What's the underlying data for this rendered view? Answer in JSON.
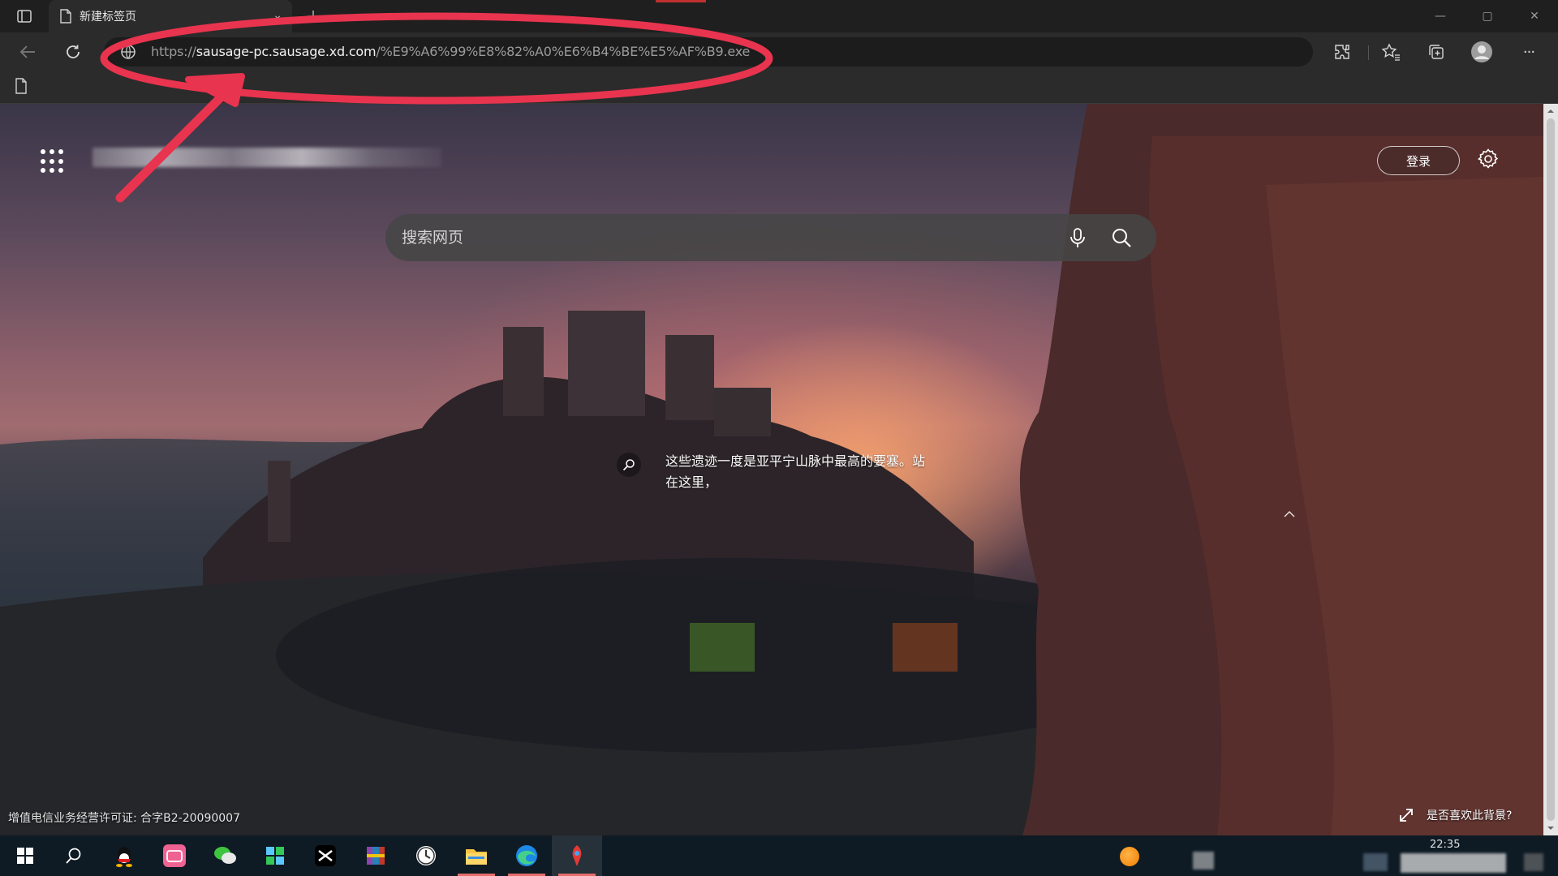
{
  "browser": {
    "tab": {
      "title": "新建标签页",
      "close_glyph": "⌄"
    },
    "window_controls": {
      "minimize": "—",
      "maximize": "▢",
      "close": "✕"
    },
    "address": {
      "protocol": "https://",
      "host": "sausage-pc.sausage.xd.com",
      "path": "/%E9%A6%99%E8%82%A0%E6%B4%BE%E5%AF%B9.exe"
    },
    "toolbar_icons": [
      "extensions-icon",
      "favorites-icon",
      "collections-icon",
      "profile-icon",
      "more-icon"
    ],
    "more_label": "···"
  },
  "newtab": {
    "signin_label": "登录",
    "search_placeholder": "搜索网页",
    "caption": "这些遗迹一度是亚平宁山脉中最高的要塞。站在这里，",
    "license": "增值电信业务经营许可证: 合字B2-20090007",
    "bg_feedback": "是否喜欢此背景?"
  },
  "taskbar": {
    "apps": [
      "start-icon",
      "search-icon",
      "qq-icon",
      "bilibili-icon",
      "wechat-icon",
      "tiles-app-icon",
      "capcut-icon",
      "winrar-icon",
      "clock-app-icon",
      "file-explorer-icon",
      "edge-icon",
      "game-app-icon"
    ],
    "clock_time": "22:35"
  },
  "colors": {
    "annotation": "#e8344e",
    "accent_taskbar_underline": "#e36c6c",
    "address_bg": "#1c1c1c",
    "chrome_bg": "#2b2b2b"
  }
}
